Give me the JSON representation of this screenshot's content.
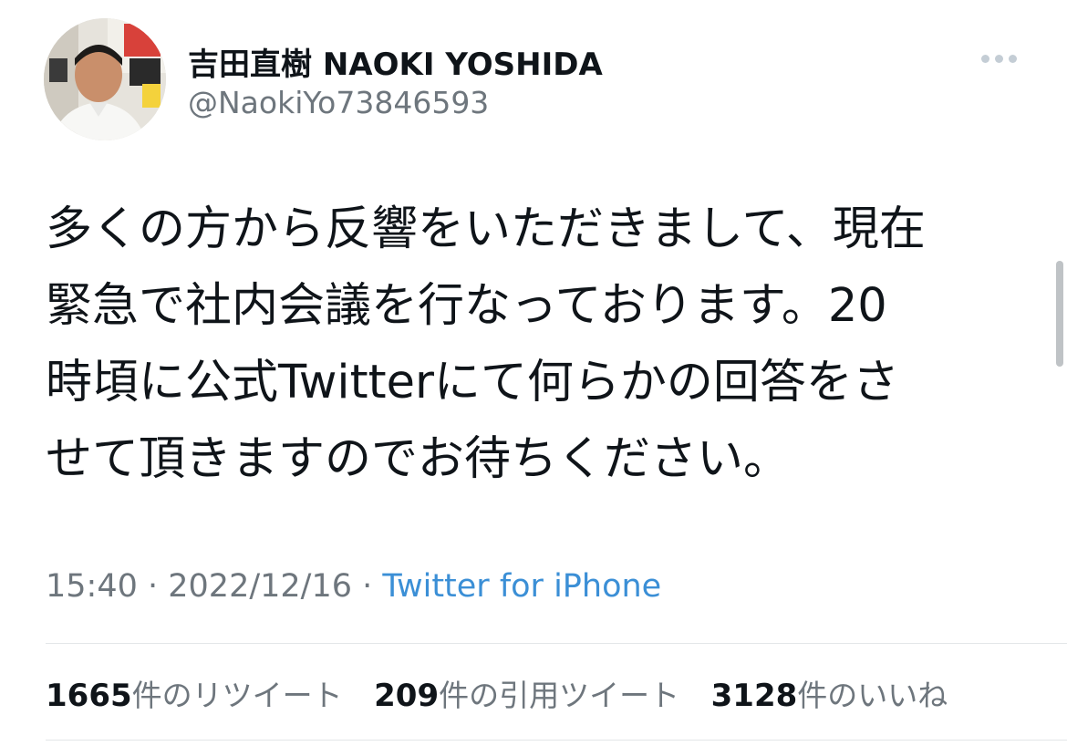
{
  "author": {
    "display_name": "吉田直樹 NAOKI YOSHIDA",
    "handle": "@NaokiYo73846593"
  },
  "tweet": {
    "lines": [
      "多くの方から反響をいただきまして、現在",
      "緊急で社内会議を行なっております。20",
      "時頃に公式Twitterにて何らかの回答をさ",
      "せて頂きますのでお待ちください。"
    ],
    "time": "15:40",
    "separator1": " · ",
    "date": "2022/12/16",
    "separator2": " · ",
    "source": "Twitter for iPhone"
  },
  "stats": {
    "retweets": {
      "count": "1665",
      "label": "件のリツイート"
    },
    "quotes": {
      "count": "209",
      "label": "件の引用ツイート"
    },
    "likes": {
      "count": "3128",
      "label": "件のいいね"
    }
  },
  "icons": {
    "more": "more-horizontal-icon"
  },
  "colors": {
    "text_primary": "#0f1419",
    "text_secondary": "#6e767d",
    "link": "#3b8fd6"
  }
}
